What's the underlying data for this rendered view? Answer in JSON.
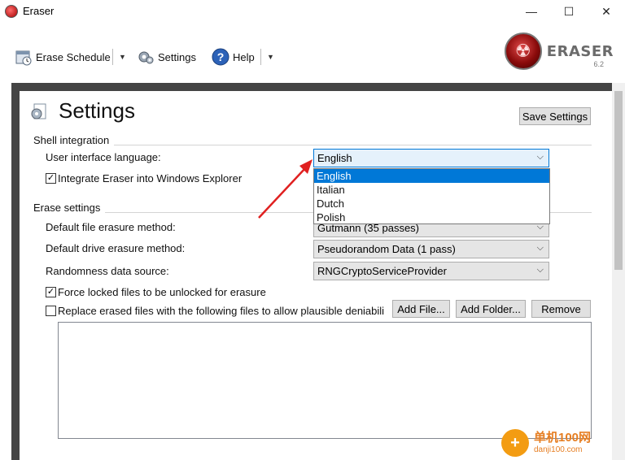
{
  "window": {
    "title": "Eraser",
    "minimize_glyph": "—",
    "maximize_glyph": "☐",
    "close_glyph": "✕"
  },
  "toolbar": {
    "erase_schedule_label": "Erase Schedule",
    "settings_label": "Settings",
    "help_label": "Help",
    "dropdown_caret": "▼"
  },
  "logo": {
    "name": "ERASER",
    "version": "6.2"
  },
  "page": {
    "title": "Settings",
    "save_button_label": "Save Settings"
  },
  "shell_integration": {
    "heading": "Shell integration",
    "language_label": "User interface language:",
    "language_value": "English",
    "language_options": [
      "English",
      "Italian",
      "Dutch",
      "Polish"
    ],
    "integrate_label": "Integrate Eraser into Windows Explorer",
    "integrate_checked": true
  },
  "erase_settings": {
    "heading": "Erase settings",
    "file_method_label": "Default file erasure method:",
    "file_method_value": "Gutmann (35 passes)",
    "drive_method_label": "Default drive erasure method:",
    "drive_method_value": "Pseudorandom Data (1 pass)",
    "random_source_label": "Randomness data source:",
    "random_source_value": "RNGCryptoServiceProvider",
    "force_unlock_label": "Force locked files to be unlocked for erasure",
    "force_unlock_checked": true,
    "replace_label": "Replace erased files with the following files to allow plausible deniabili",
    "replace_checked": false,
    "add_file_label": "Add File...",
    "add_folder_label": "Add Folder...",
    "remove_label": "Remove"
  },
  "watermark": {
    "cn": "单机100网",
    "url": "danji100.com"
  },
  "glyphs": {
    "check": "✓",
    "chevron": "⌵"
  },
  "colors": {
    "accent": "#0078d7",
    "selected_bg": "#e5f1fb",
    "arrow": "#e02020"
  }
}
